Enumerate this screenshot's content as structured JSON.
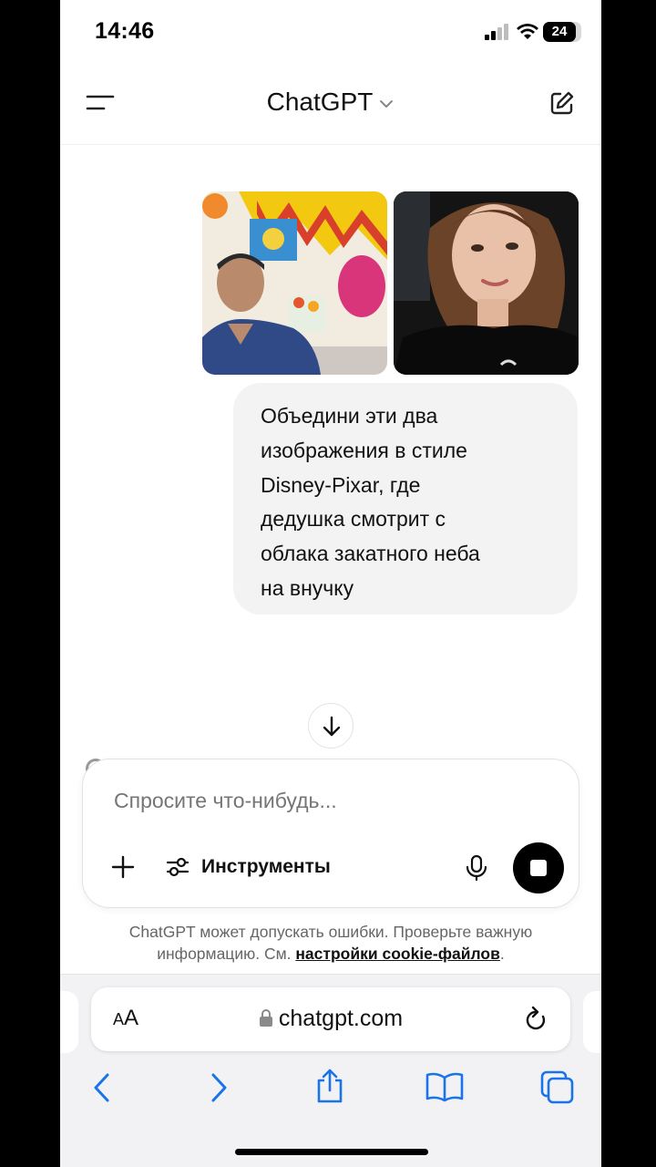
{
  "status_bar": {
    "time": "14:46",
    "battery": "24"
  },
  "header": {
    "title": "ChatGPT"
  },
  "attachments": [
    {
      "name": "photo-grandfather"
    },
    {
      "name": "photo-granddaughter"
    }
  ],
  "message": {
    "lines": [
      "Объедини эти два",
      "изображения в стиле",
      "Disney-Pixar, где",
      "дедушка смотрит с",
      "облака закатного неба",
      "на внучку"
    ]
  },
  "composer": {
    "placeholder": "Спросите что-нибудь...",
    "tools_label": "Инструменты"
  },
  "disclaimer": {
    "line1": "ChatGPT может допускать ошибки. Проверьте важную",
    "line2_prefix": "информацию. См. ",
    "link": "настройки cookie-файлов",
    "line2_suffix": "."
  },
  "browser": {
    "aa_label_small": "A",
    "aa_label_big": "A",
    "url": "chatgpt.com"
  },
  "colors": {
    "accent": "#1a73e8",
    "bubble": "#f3f3f3"
  },
  "icons": [
    "menu-icon",
    "chevron-down-icon",
    "new-chat-icon",
    "arrow-down-icon",
    "plus-icon",
    "sliders-icon",
    "microphone-icon",
    "stop-icon",
    "lock-icon",
    "reload-icon",
    "back-icon",
    "forward-icon",
    "share-icon",
    "bookmarks-icon",
    "tabs-icon"
  ]
}
